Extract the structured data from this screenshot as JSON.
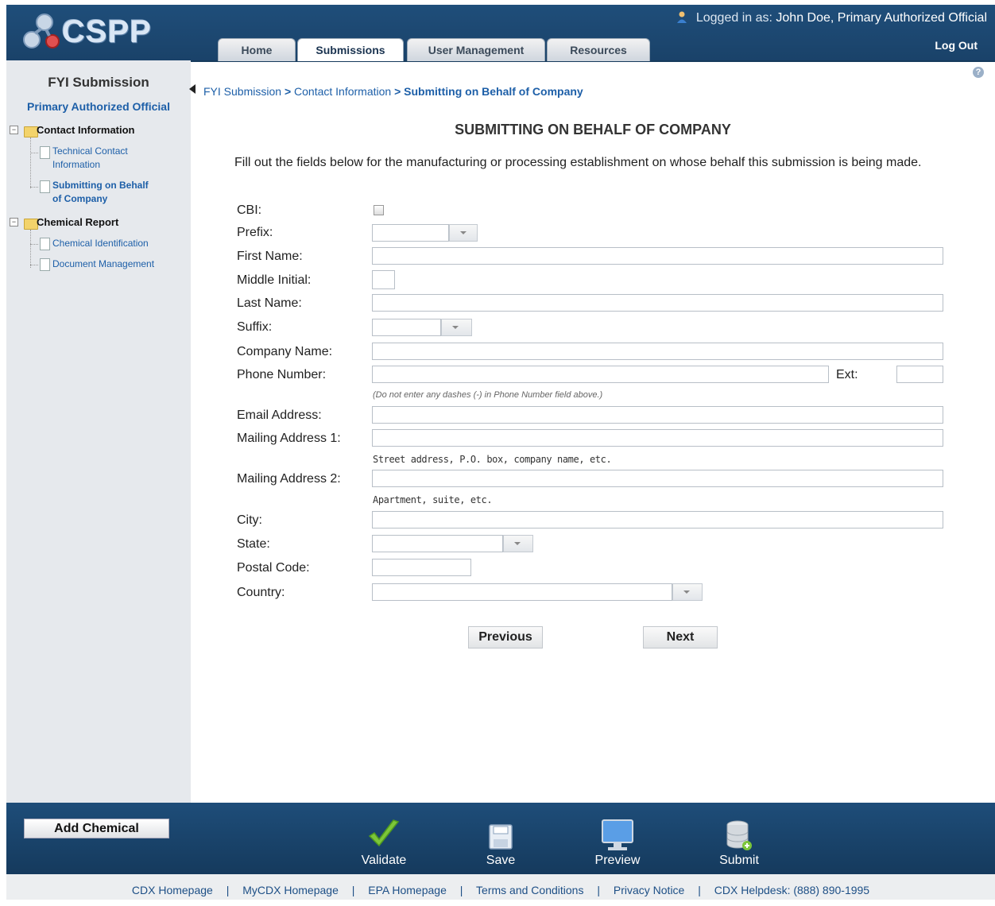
{
  "header": {
    "logo_text": "CSPP",
    "logged_in_prefix": "Logged in as:",
    "user_name": "John Doe, Primary Authorized Official",
    "logout_label": "Log Out",
    "tabs": [
      {
        "label": "Home"
      },
      {
        "label": "Submissions"
      },
      {
        "label": "User Management"
      },
      {
        "label": "Resources"
      }
    ]
  },
  "sidebar": {
    "title": "FYI Submission",
    "role": "Primary Authorized Official",
    "nodes": [
      {
        "label": "Contact Information",
        "children": [
          "Technical Contact Information",
          "Submitting on Behalf of Company"
        ]
      },
      {
        "label": "Chemical Report",
        "children": [
          "Chemical Identification",
          "Document Management"
        ]
      }
    ],
    "leaf_lines": {
      "technical_1": "Technical Contact",
      "technical_2": "Information",
      "behalf_1": "Submitting on Behalf",
      "behalf_2": "of Company"
    }
  },
  "breadcrumb": {
    "items": [
      "FYI Submission",
      "Contact Information",
      "Submitting on Behalf of Company"
    ],
    "separator": ">"
  },
  "page": {
    "title": "SUBMITTING ON BEHALF OF COMPANY",
    "intro": "Fill out the fields below for the manufacturing or processing establishment on whose behalf this submission is being made."
  },
  "form": {
    "cbi_label": "CBI:",
    "prefix_label": "Prefix:",
    "first_name_label": "First Name:",
    "middle_initial_label": "Middle Initial:",
    "last_name_label": "Last Name:",
    "suffix_label": "Suffix:",
    "company_name_label": "Company Name:",
    "phone_label": "Phone Number:",
    "ext_label": "Ext:",
    "phone_hint": "(Do not enter any dashes (-) in Phone Number field above.)",
    "email_label": "Email Address:",
    "mailing1_label": "Mailing Address 1:",
    "mailing1_help": "Street address, P.O. box, company name, etc.",
    "mailing2_label": "Mailing Address 2:",
    "mailing2_help": "Apartment, suite, etc.",
    "city_label": "City:",
    "state_label": "State:",
    "postal_label": "Postal Code:",
    "country_label": "Country:",
    "values": {
      "cbi_checked": false,
      "prefix": "",
      "first_name": "",
      "middle_initial": "",
      "last_name": "",
      "suffix": "",
      "company_name": "",
      "phone": "",
      "ext": "",
      "email": "",
      "mailing1": "",
      "mailing2": "",
      "city": "",
      "state": "",
      "postal": "",
      "country": ""
    }
  },
  "nav_buttons": {
    "previous": "Previous",
    "next": "Next"
  },
  "bottom_bar": {
    "add_chemical": "Add Chemical",
    "actions": [
      {
        "label": "Validate",
        "icon": "checkmark-icon"
      },
      {
        "label": "Save",
        "icon": "save-icon"
      },
      {
        "label": "Preview",
        "icon": "monitor-icon"
      },
      {
        "label": "Submit",
        "icon": "database-icon"
      }
    ]
  },
  "footer": {
    "links": [
      "CDX Homepage",
      "MyCDX Homepage",
      "EPA Homepage",
      "Terms and Conditions",
      "Privacy Notice",
      "CDX Helpdesk: (888) 890-1995"
    ],
    "separator": "|"
  },
  "colors": {
    "header_bg": "#1f4e7a",
    "link_blue": "#1d5fa8",
    "sidebar_bg": "#e6e9ed",
    "bottom_bar_bg": "#1e4d79"
  }
}
